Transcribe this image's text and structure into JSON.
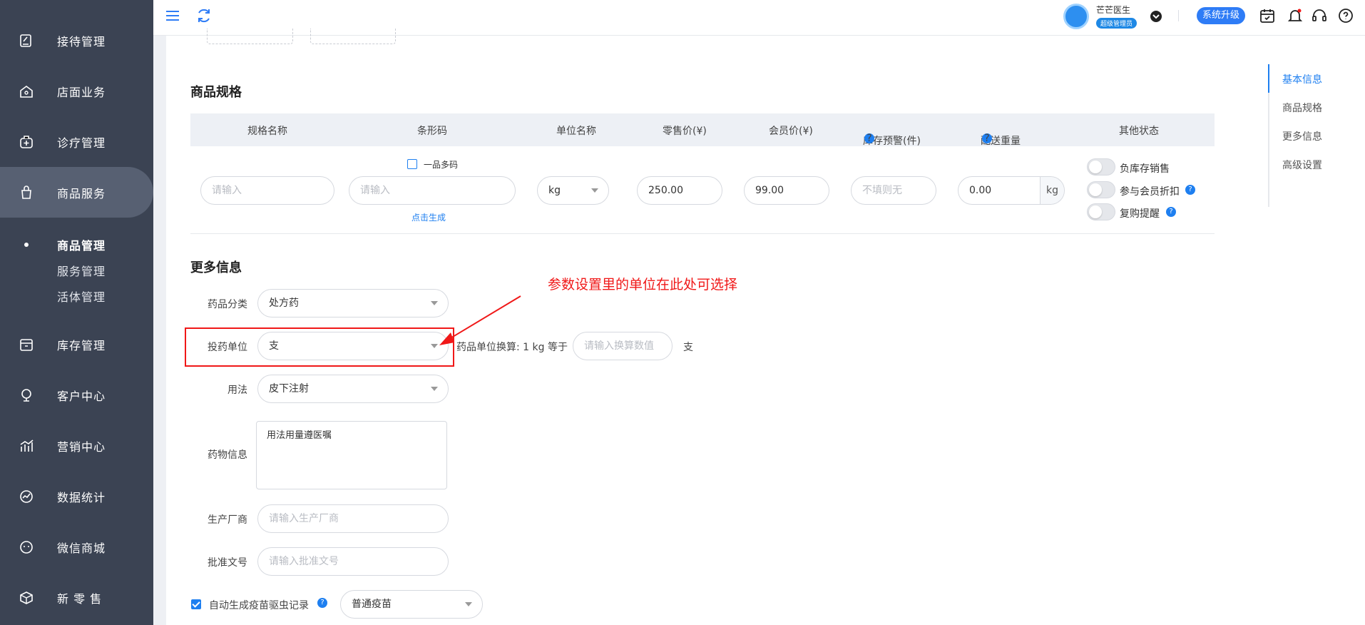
{
  "sidebar": {
    "items": [
      {
        "label": "接待管理",
        "icon": "reception-icon"
      },
      {
        "label": "店面业务",
        "icon": "store-icon"
      },
      {
        "label": "诊疗管理",
        "icon": "medical-icon"
      },
      {
        "label": "商品服务",
        "icon": "goods-icon"
      },
      {
        "label": "库存管理",
        "icon": "inventory-icon"
      },
      {
        "label": "客户中心",
        "icon": "customer-icon"
      },
      {
        "label": "营销中心",
        "icon": "marketing-icon"
      },
      {
        "label": "数据统计",
        "icon": "statistics-icon"
      },
      {
        "label": "微信商城",
        "icon": "wechat-mall-icon"
      },
      {
        "label": "新 零 售",
        "icon": "retail-icon"
      }
    ],
    "sub_items": [
      {
        "label": "商品管理"
      },
      {
        "label": "服务管理"
      },
      {
        "label": "活体管理"
      }
    ]
  },
  "topbar": {
    "user_name": "芒芒医生",
    "role": "超级管理员",
    "upgrade_label": "系统升级"
  },
  "spec": {
    "title": "商品规格",
    "headers": [
      "规格名称",
      "条形码",
      "单位名称",
      "零售价(¥)",
      "会员价(¥)",
      "库存预警(件)",
      "配送重量",
      "其他状态"
    ],
    "help_mark": "?",
    "multi_code_label": "一品多码",
    "name_placeholder": "请输入",
    "barcode_placeholder": "请输入",
    "generate_link": "点击生成",
    "unit_value": "kg",
    "retail_price": "250.00",
    "member_price": "99.00",
    "stock_warning_placeholder": "不填则无",
    "weight_value": "0.00",
    "weight_unit": "kg",
    "switches": [
      "负库存销售",
      "参与会员折扣",
      "复购提醒"
    ]
  },
  "more": {
    "title": "更多信息",
    "category_label": "药品分类",
    "category_value": "处方药",
    "dose_unit_label": "投药单位",
    "dose_unit_value": "支",
    "conversion_text": "药品单位换算: 1 kg 等于",
    "conversion_placeholder": "请输入换算数值",
    "conversion_unit": "支",
    "usage_label": "用法",
    "usage_value": "皮下注射",
    "drug_info_label": "药物信息",
    "drug_info_value": "用法用量遵医嘱",
    "manufacturer_label": "生产厂商",
    "manufacturer_placeholder": "请输入生产厂商",
    "approval_label": "批准文号",
    "approval_placeholder": "请输入批准文号",
    "vaccine_check_label": "自动生成疫苗驱虫记录",
    "vaccine_value": "普通疫苗"
  },
  "annotation": {
    "text": "参数设置里的单位在此处可选择",
    "color": "#f01818"
  },
  "right_nav": {
    "items": [
      "基本信息",
      "商品规格",
      "更多信息",
      "高级设置"
    ]
  },
  "colors": {
    "sidebar_bg": "#3b4353",
    "accent": "#1e7ff0"
  }
}
